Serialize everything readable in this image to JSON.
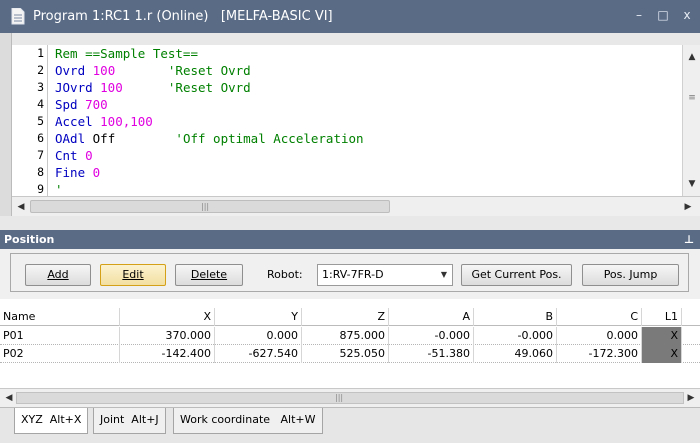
{
  "window": {
    "title": "Program 1:RC1 1.r (Online)   [MELFA-BASIC VI]",
    "icons": [
      "document-icon",
      "minimize-icon",
      "restore-icon",
      "close-icon"
    ],
    "buttons": {
      "minimize": "–",
      "restore": "□",
      "close": "x"
    }
  },
  "editor": {
    "lines": [
      {
        "n": "1",
        "parts": [
          {
            "t": "Rem ==Sample Test==",
            "c": "cmt"
          }
        ]
      },
      {
        "n": "2",
        "parts": [
          {
            "t": "Ovrd ",
            "c": "kw"
          },
          {
            "t": "100",
            "c": "num"
          },
          {
            "t": "       'Reset Ovrd",
            "c": "cmt"
          }
        ]
      },
      {
        "n": "3",
        "parts": [
          {
            "t": "JOvrd ",
            "c": "kw"
          },
          {
            "t": "100",
            "c": "num"
          },
          {
            "t": "      'Reset Ovrd",
            "c": "cmt"
          }
        ]
      },
      {
        "n": "4",
        "parts": [
          {
            "t": "Spd ",
            "c": "kw"
          },
          {
            "t": "700",
            "c": "num"
          }
        ]
      },
      {
        "n": "5",
        "parts": [
          {
            "t": "Accel ",
            "c": "kw"
          },
          {
            "t": "100,100",
            "c": "num"
          }
        ]
      },
      {
        "n": "6",
        "parts": [
          {
            "t": "OAdl ",
            "c": "kw"
          },
          {
            "t": "Off",
            "c": "plain"
          },
          {
            "t": "        'Off optimal Acceleration",
            "c": "cmt"
          }
        ]
      },
      {
        "n": "7",
        "parts": [
          {
            "t": "Cnt ",
            "c": "kw"
          },
          {
            "t": "0",
            "c": "num"
          }
        ]
      },
      {
        "n": "8",
        "parts": [
          {
            "t": "Fine ",
            "c": "kw"
          },
          {
            "t": "0",
            "c": "num"
          }
        ]
      },
      {
        "n": "9",
        "parts": [
          {
            "t": "'",
            "c": "cmt"
          }
        ]
      }
    ]
  },
  "position_panel": {
    "title": "Position",
    "pin_glyph": "ᵖ",
    "toolbar": {
      "add_label": "Add",
      "edit_label": "Edit",
      "delete_label": "Delete",
      "robot_label": "Robot:",
      "robot_value": "1:RV-7FR-D",
      "get_current_label": "Get Current Pos.",
      "pos_jump_label": "Pos. Jump"
    },
    "grid": {
      "columns": [
        "Name",
        "X",
        "Y",
        "Z",
        "A",
        "B",
        "C",
        "L1"
      ],
      "rows": [
        [
          "P01",
          "370.000",
          "0.000",
          "875.000",
          "-0.000",
          "-0.000",
          "0.000",
          "X"
        ],
        [
          "P02",
          "-142.400",
          "-627.540",
          "525.050",
          "-51.380",
          "49.060",
          "-172.300",
          "X"
        ]
      ]
    },
    "tabs": [
      "XYZ  Alt+X",
      "Joint  Alt+J",
      "Work coordinate   Alt+W"
    ]
  },
  "colors": {
    "titlebar": "#5a6b86",
    "keyword": "#0000c0",
    "number": "#e000e0",
    "comment": "#008000"
  }
}
